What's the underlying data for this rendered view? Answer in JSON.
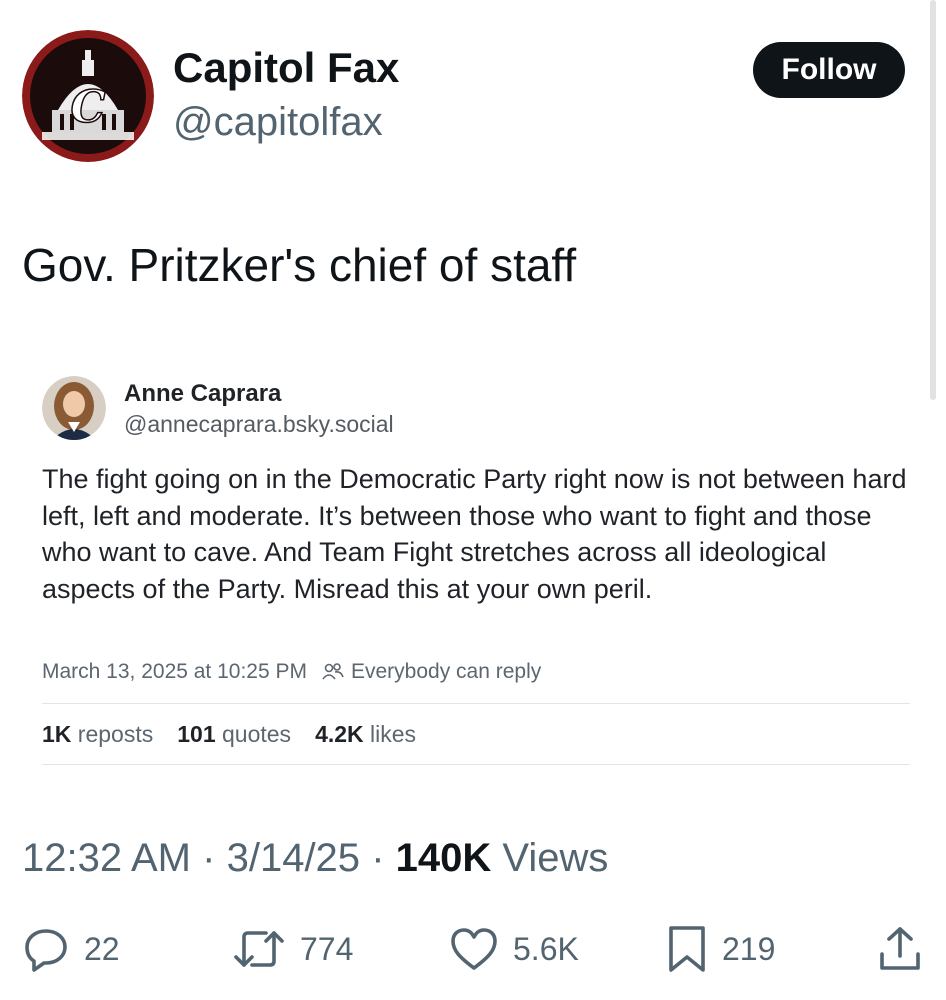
{
  "author": {
    "display_name": "Capitol Fax",
    "handle": "@capitolfax",
    "avatar_icon": "capitol-dome-logo-icon",
    "avatar_logo_letter": "C"
  },
  "follow_label": "Follow",
  "tweet_text": "Gov. Pritzker's chief of staff",
  "quoted": {
    "name": "Anne Caprara",
    "handle": "@annecaprara.bsky.social",
    "avatar_icon": "profile-photo-icon",
    "body": "The fight going on in the Democratic Party right now is not between hard left, left and moderate.  It’s between those who want to fight and those who want to cave. And Team Fight stretches across all ideological aspects of the Party. Misread this at your own peril.",
    "date": "March 13, 2025 at 10:25 PM",
    "reply_setting": "Everybody can reply",
    "reposts_count": "1K",
    "reposts_label": "reposts",
    "quotes_count": "101",
    "quotes_label": "quotes",
    "likes_count": "4.2K",
    "likes_label": "likes"
  },
  "meta": {
    "time": "12:32 AM",
    "sep1": "·",
    "date": "3/14/25",
    "sep2": "·",
    "views_count": "140K",
    "views_label": "Views"
  },
  "actions": {
    "replies": "22",
    "reposts": "774",
    "likes": "5.6K",
    "bookmarks": "219",
    "icons": [
      "reply-icon",
      "repost-icon",
      "like-icon",
      "bookmark-icon",
      "share-icon"
    ]
  },
  "colors": {
    "text_primary": "#0f1419",
    "text_secondary": "#536471",
    "follow_bg": "#0f1419",
    "logo_red": "#8b1a1a"
  }
}
